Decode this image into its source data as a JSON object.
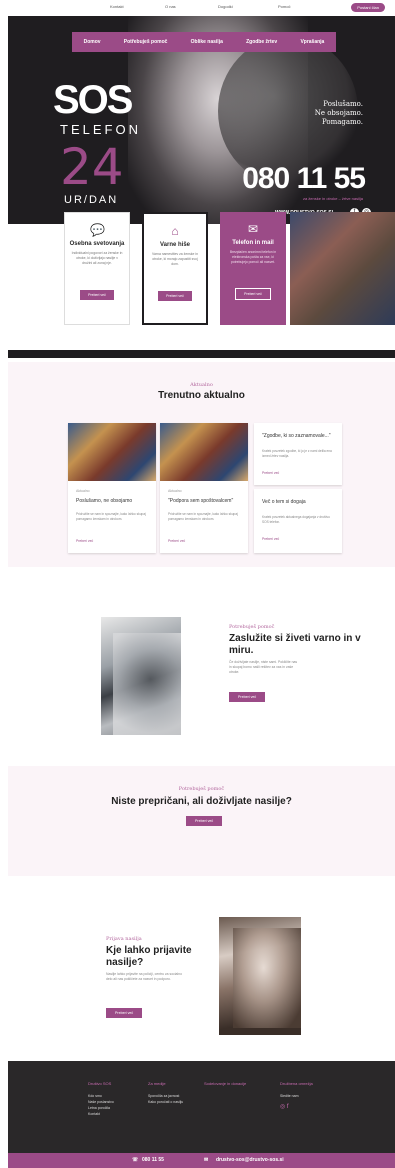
{
  "topbar": {
    "links": [
      "Kontakt",
      "O nas",
      "Dogodki",
      "Pomoč"
    ],
    "cta": "Postani član"
  },
  "hero": {
    "nav": [
      "Domov",
      "Potřebuješ pomoč",
      "Oblike nasilja",
      "Zgodbe žrtev",
      "Vprašanja"
    ],
    "logo_sos": "SOS",
    "logo_telefon": "TELEFON",
    "logo_24": "24",
    "logo_urdan": "UR/DAN",
    "slogan": [
      "Poslušamo.",
      "Ne obsojamo.",
      "Pomagamo."
    ],
    "phone": "080 11 55",
    "phone_sub": "za ženske in otroke – žrtve nasilja",
    "web": "WWW.DRUSTVO-SOS.SI"
  },
  "cards": [
    {
      "title": "Osebna svetovanja",
      "desc": "Individualni pogovori za ženske in otroke, ki doživljajo nasilje v družini ali zunaj nje.",
      "button": "Preberi več",
      "icon": "chat-icon"
    },
    {
      "title": "Varne hiše",
      "desc": "Varna namestitev za ženske in otroke, ki morajo zapustiti svoj dom.",
      "button": "Preberi več",
      "icon": "house-icon"
    },
    {
      "title": "Telefon in mail",
      "desc": "Brezplačen anonimni telefon in elektronska pošta za vse, ki potrebujejo pomoč ali nasvet.",
      "button": "Preberi več",
      "icon": "mail-icon"
    }
  ],
  "aktualno": {
    "kicker": "Aktualno",
    "title": "Trenutno aktualno",
    "items": [
      {
        "cat": "Aktualno",
        "title": "Poslušamo, ne obsojamo",
        "desc": "Pridružite se nam in spoznajte, kako lahko skupaj pomagamo ženskam in otrokom.",
        "more": "Preberi več"
      },
      {
        "cat": "Aktualno",
        "title": "\"Podpora sem spoštovalcem\"",
        "desc": "Pridružite se nam in spoznajte, kako lahko skupaj pomagamo ženskam in otrokom.",
        "more": "Preberi več"
      },
      {
        "cat": "",
        "title": "\"Zgodbe, ki so zaznamovale...\"",
        "desc": "Kratek povzetek zgodbe, ki jo je z nami delila ena izmed žrtev nasilja.",
        "more": "Preberi več"
      },
      {
        "cat": "",
        "title": "Več o tem si dogaja",
        "desc": "Kratek povzetek aktualnega dogajanja v društvu SOS telefon.",
        "more": "Preberi več"
      }
    ]
  },
  "varno": {
    "kicker": "Potrebuješ pomoč",
    "title": "Zaslužite si živeti varno in v miru.",
    "desc": "Če doživljate nasilje, niste sami. Pokličite nas in skupaj bomo našli rešitev za vas in vaše otroke.",
    "button": "Preberi več"
  },
  "niste": {
    "kicker": "Potrebuješ pomoč",
    "title": "Niste prepričani, ali doživljate nasilje?",
    "button": "Preberi več"
  },
  "prijava": {
    "kicker": "Prijava nasilja",
    "title": "Kje lahko prijavite nasilje?",
    "desc": "Nasilje lahko prijavite na policiji, centru za socialno delo ali nas pokličete za nasvet in podporo.",
    "button": "Preberi več"
  },
  "footer": {
    "cols": [
      {
        "title": "Društvo SOS",
        "items": [
          "Kdo smo",
          "Naše poslanstvo",
          "Letna poročila",
          "Kontakt"
        ]
      },
      {
        "title": "Za medije",
        "items": [
          "Sporočila za javnost",
          "Kako poročati o nasilju"
        ]
      },
      {
        "title": "Sodelovanje in donacije",
        "items": []
      },
      {
        "title": "Družbena omrežja",
        "items": [
          "Sledite nam"
        ]
      }
    ],
    "phone": "080 11 55",
    "email": "drustvo-sos@drustvo-sos.si"
  },
  "colors": {
    "accent": "#9b4b87",
    "dark": "#1f1d20",
    "pink_bg": "#fbf4f8"
  }
}
